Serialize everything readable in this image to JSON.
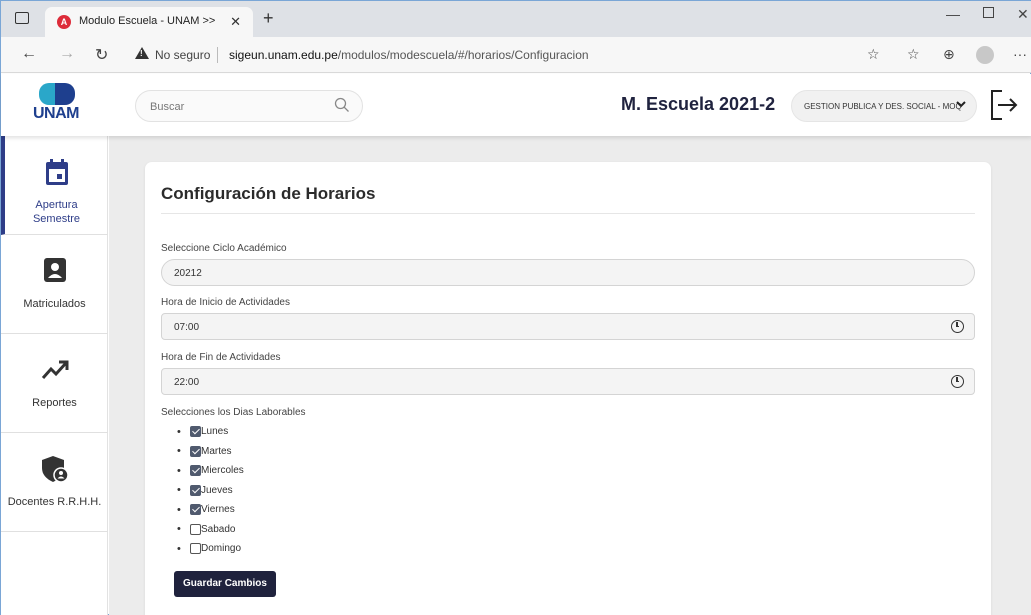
{
  "browser": {
    "tab_title": "Modulo Escuela - UNAM >>",
    "tab_favicon": "angular-icon",
    "security": "No seguro",
    "url_host": "sigeun.unam.edu.pe",
    "url_path": "/modulos/modescuela/#/horarios/Configuracion"
  },
  "header": {
    "logo_text": "UNAM",
    "search_placeholder": "Buscar",
    "brand_title": "M. Escuela 2021-2",
    "school_select": "GESTION PUBLICA Y DES. SOCIAL - MOQ"
  },
  "sidebar": {
    "items": [
      {
        "label": "Apertura Semestre",
        "icon": "calendar-icon",
        "active": true
      },
      {
        "label": "Matriculados",
        "icon": "id-card-icon",
        "active": false
      },
      {
        "label": "Reportes",
        "icon": "trending-up-icon",
        "active": false
      },
      {
        "label": "Docentes R.R.H.H.",
        "icon": "shield-user-icon",
        "active": false
      }
    ]
  },
  "form": {
    "title": "Configuración de Horarios",
    "ciclo_label": "Seleccione Ciclo Académico",
    "ciclo_value": "20212",
    "inicio_label": "Hora de Inicio de Actividades",
    "inicio_value": "07:00",
    "fin_label": "Hora de Fin de Actividades",
    "fin_value": "22:00",
    "dias_label": "Selecciones los Dias Laborables",
    "dias": [
      {
        "name": "Lunes",
        "checked": true
      },
      {
        "name": "Martes",
        "checked": true
      },
      {
        "name": "Miercoles",
        "checked": true
      },
      {
        "name": "Jueves",
        "checked": true
      },
      {
        "name": "Viernes",
        "checked": true
      },
      {
        "name": "Sabado",
        "checked": false
      },
      {
        "name": "Domingo",
        "checked": false
      }
    ],
    "save_label": "Guardar Cambios"
  },
  "colors": {
    "primary": "#1f223d",
    "sidebar_active": "#2e3d88",
    "content_bg": "#ececec"
  }
}
